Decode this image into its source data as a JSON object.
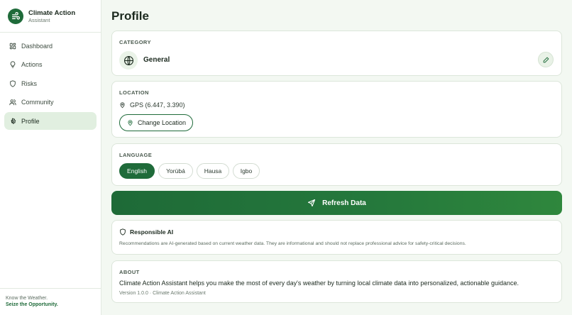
{
  "app": {
    "title": "Climate Action",
    "subtitle": "Assistant"
  },
  "nav": {
    "items": [
      {
        "label": "Dashboard",
        "icon": "grid-icon"
      },
      {
        "label": "Actions",
        "icon": "lightbulb-icon"
      },
      {
        "label": "Risks",
        "icon": "shield-icon"
      },
      {
        "label": "Community",
        "icon": "users-icon"
      },
      {
        "label": "Profile",
        "icon": "settings-icon",
        "active": true
      }
    ]
  },
  "footer": {
    "line1": "Know the Weather.",
    "line2": "Seize the Opportunity."
  },
  "page": {
    "title": "Profile"
  },
  "category": {
    "label": "CATEGORY",
    "value": "General",
    "icon": "globe-icon",
    "edit_icon": "pencil-icon"
  },
  "location": {
    "label": "LOCATION",
    "gps": "GPS (6.447, 3.390)",
    "change_button": "Change Location"
  },
  "language": {
    "label": "LANGUAGE",
    "options": [
      "English",
      "Yorùbá",
      "Hausa",
      "Igbo"
    ],
    "selected": "English"
  },
  "refresh": {
    "label": "Refresh Data",
    "icon": "send-icon"
  },
  "responsible_ai": {
    "title": "Responsible AI",
    "text": "Recommendations are AI-generated based on current weather data. They are informational and should not replace professional advice for safety-critical decisions."
  },
  "about": {
    "label": "ABOUT",
    "text": "Climate Action Assistant helps you make the most of every day's weather by turning local climate data into personalized, actionable guidance.",
    "version": "Version 1.0.0 · Climate Action Assistant"
  },
  "colors": {
    "brand": "#1f6b3a",
    "background": "#f3f8f2",
    "active_nav": "#e1efe0"
  }
}
